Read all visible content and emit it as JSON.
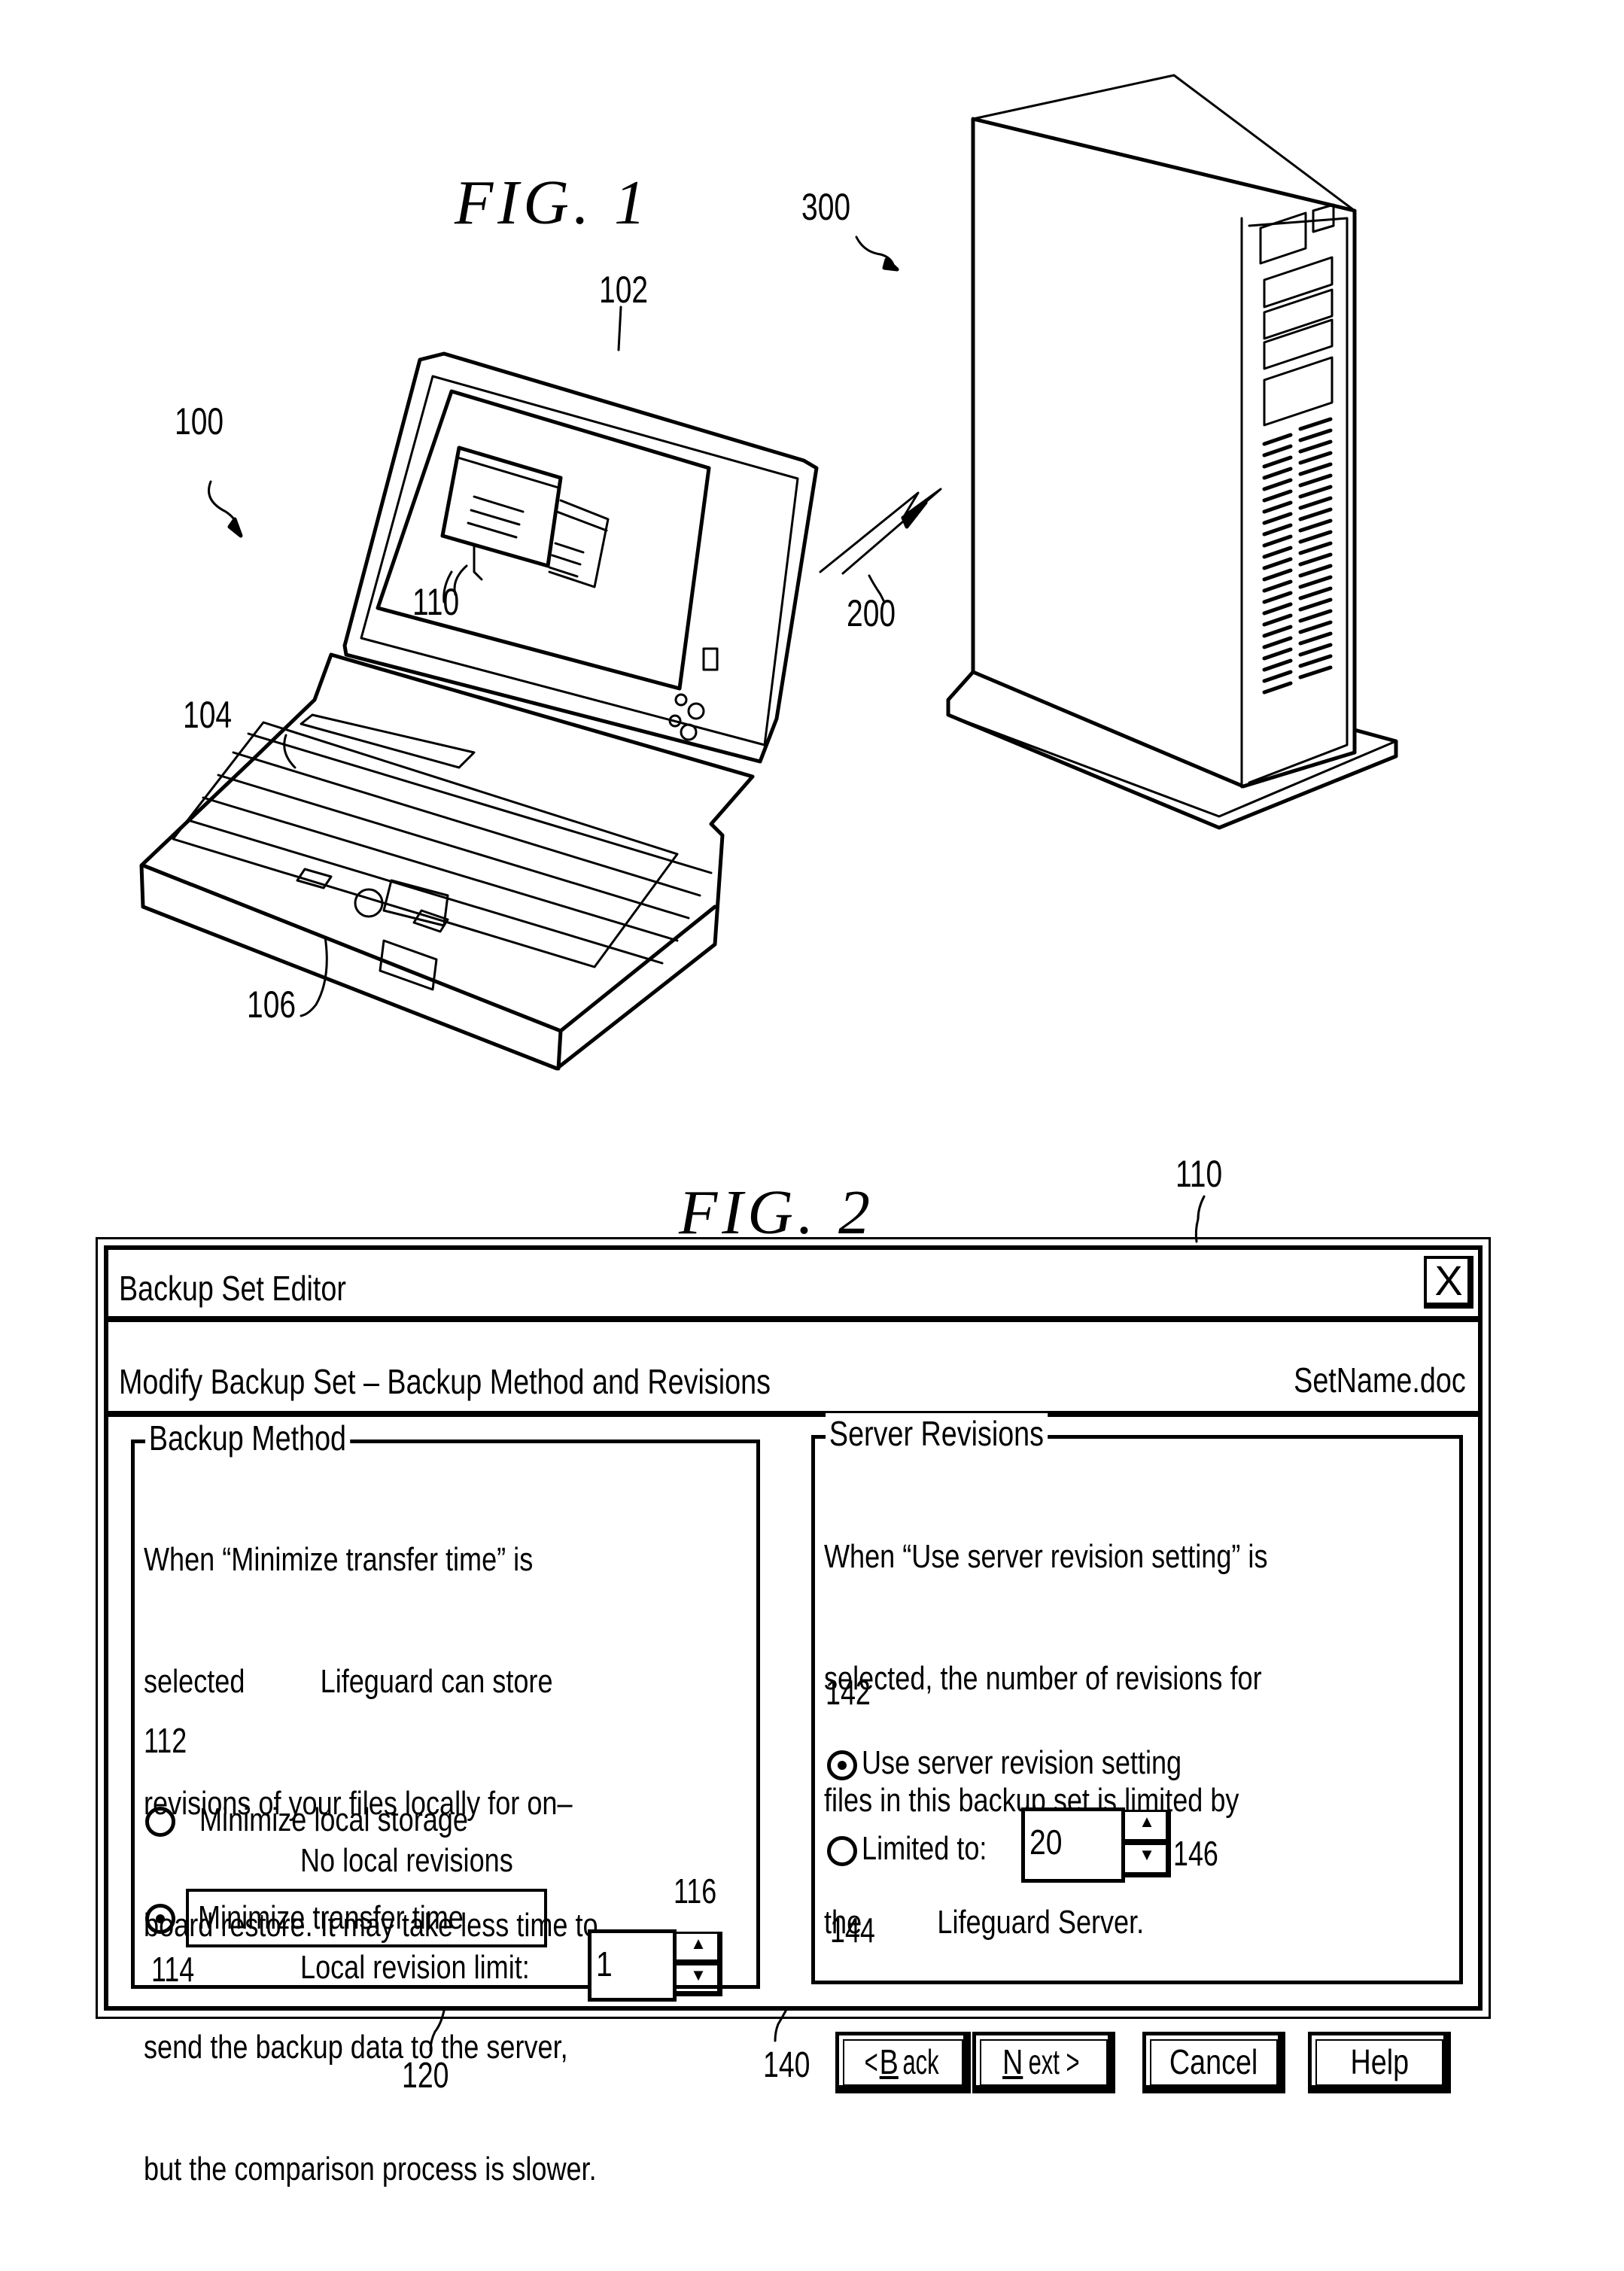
{
  "fig1": {
    "title": "FIG. 1",
    "refs": {
      "laptop": "100",
      "display": "102",
      "keyboard": "104",
      "pointing_device": "106",
      "window": "110",
      "link": "200",
      "server": "300"
    }
  },
  "fig2": {
    "title": "FIG. 2",
    "ref_dialog": "110",
    "dialog": {
      "title": "Backup Set Editor",
      "close_glyph": "X",
      "subtitle": "Modify Backup Set – Backup Method and Revisions",
      "filename": "SetName.doc",
      "backup_method": {
        "legend": "Backup Method",
        "description_lines": [
          "When “Minimize transfer time” is",
          "selected          Lifeguard can store",
          "revisions of your files locally for on–",
          "board restore. It may take less time to",
          "send the backup data to the server,",
          "but the comparison process is slower."
        ],
        "option_local_storage": {
          "label": "Minimize local storage",
          "sublabel": "No local revisions",
          "selected": false
        },
        "option_transfer_time": {
          "label": "Minimize transfer time",
          "selected": true
        },
        "local_revision_limit_label": "Local revision limit:",
        "local_revision_limit_value": "1",
        "ref_group": "120",
        "ref_radio_local": "112",
        "ref_radio_transfer": "114",
        "ref_spinner": "116"
      },
      "server_revisions": {
        "legend": "Server Revisions",
        "description_lines": [
          "When “Use server revision setting” is",
          "selected, the number of revisions for",
          "files in this backup set is limited by",
          "the          Lifeguard Server."
        ],
        "option_use_server": {
          "label": "Use server revision setting",
          "selected": true
        },
        "option_limited": {
          "label": "Limited to:",
          "selected": false
        },
        "limited_value": "20",
        "ref_group": "140",
        "ref_radio_server": "142",
        "ref_radio_limited": "144",
        "ref_spinner": "146"
      },
      "buttons": {
        "back_prefix": "< ",
        "back_mnemonic": "B",
        "back_rest": "ack",
        "next_mnemonic": "N",
        "next_rest": "ext >",
        "cancel": "Cancel",
        "help": "Help"
      },
      "spinner_up_glyph": "▲",
      "spinner_down_glyph": "▼"
    }
  }
}
